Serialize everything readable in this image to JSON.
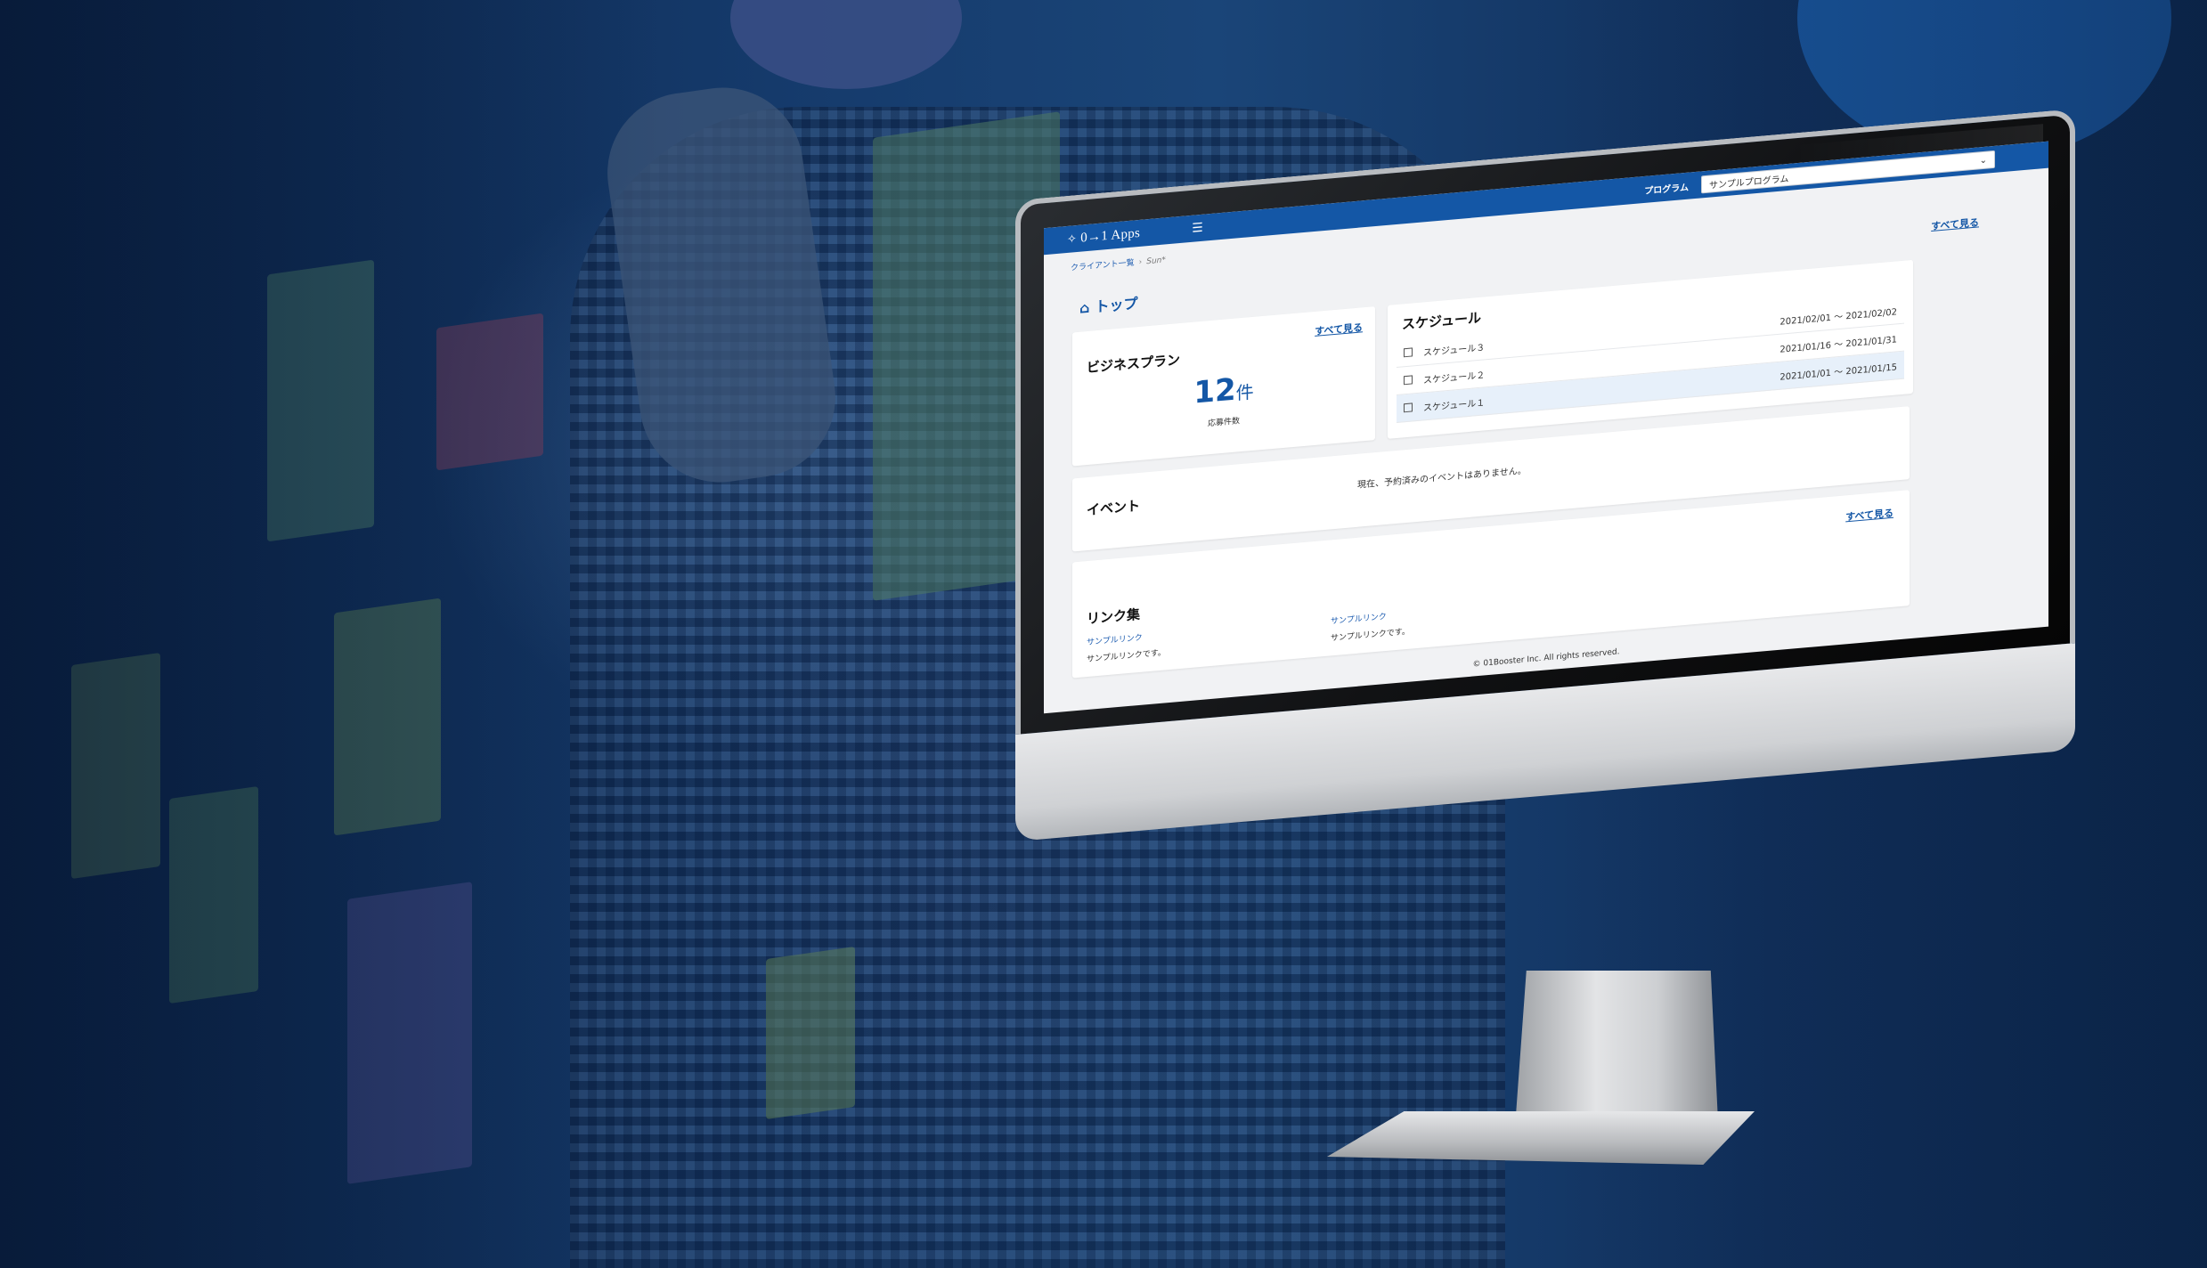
{
  "app": {
    "logo_text": "0→1 Apps",
    "logo_mark": "✧",
    "menu_icon": "hamburger-icon",
    "program_label": "プログラム",
    "program_selected": "サンプルプログラム",
    "program_chevron": "⌄"
  },
  "breadcrumb": {
    "items": [
      "クライアント一覧",
      "Sun*"
    ]
  },
  "page": {
    "title": "トップ",
    "see_all": "すべて見る"
  },
  "business_plan": {
    "title": "ビジネスプラン",
    "see_all": "すべて見る",
    "count": "12",
    "unit": "件",
    "count_label": "応募件数"
  },
  "schedule": {
    "title": "スケジュール",
    "items": [
      {
        "name": "スケジュール３",
        "period": "2021/02/01 〜 2021/02/02"
      },
      {
        "name": "スケジュール２",
        "period": "2021/01/16 〜 2021/01/31"
      },
      {
        "name": "スケジュール１",
        "period": "2021/01/01 〜 2021/01/15"
      }
    ]
  },
  "event": {
    "title": "イベント",
    "message": "現在、予約済みのイベントはありません。"
  },
  "links": {
    "title": "リンク集",
    "see_all": "すべて見る",
    "items": [
      {
        "label": "サンプルリンク",
        "description": "サンプルリンクです。"
      },
      {
        "label": "サンプルリンク",
        "description": "サンプルリンクです。"
      }
    ]
  },
  "footer": {
    "text": "© 01Booster Inc. All rights reserved."
  },
  "colors": {
    "brand": "#1457a6",
    "background": "#0f2d57"
  }
}
